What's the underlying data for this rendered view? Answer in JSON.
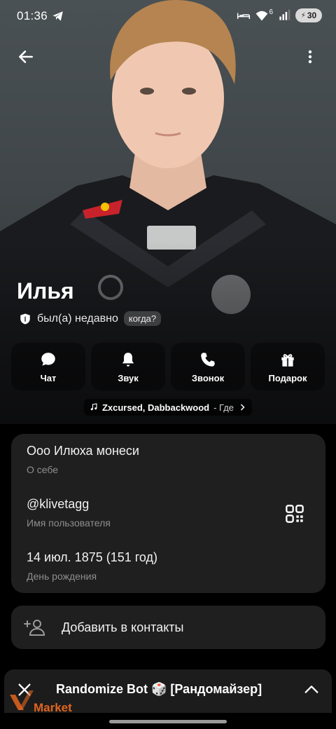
{
  "status_bar": {
    "time": "01:36",
    "network_badge": "6",
    "battery": "30",
    "icons": [
      "telegram-icon",
      "bed-icon",
      "wifi-icon",
      "signal-icon",
      "battery-icon"
    ]
  },
  "profile": {
    "name": "Илья",
    "status": "был(а) недавно",
    "when_button": "когда?"
  },
  "actions": [
    {
      "label": "Чат",
      "icon": "chat-bubble-icon"
    },
    {
      "label": "Звук",
      "icon": "bell-icon"
    },
    {
      "label": "Звонок",
      "icon": "phone-icon"
    },
    {
      "label": "Подарок",
      "icon": "gift-icon"
    }
  ],
  "music": {
    "artist": "Zxcursed, Dabbackwood",
    "separator": "- Где"
  },
  "info": {
    "bio_value": "Ооо Илюха монеси",
    "bio_label": "О себе",
    "username_value": "@klivetagg",
    "username_label": "Имя пользователя",
    "birthday_value": "14 июл. 1875 (151 год)",
    "birthday_label": "День рождения"
  },
  "add_contact": {
    "label": "Добавить в контакты"
  },
  "bot_bar": {
    "title": "Randomize Bot 🎲 [Рандомайзер]"
  },
  "watermark": {
    "text": "Market"
  },
  "colors": {
    "card_bg": "#1f1f1f",
    "secondary_text": "#8e8e8e",
    "watermark_accent": "#e0651f"
  }
}
